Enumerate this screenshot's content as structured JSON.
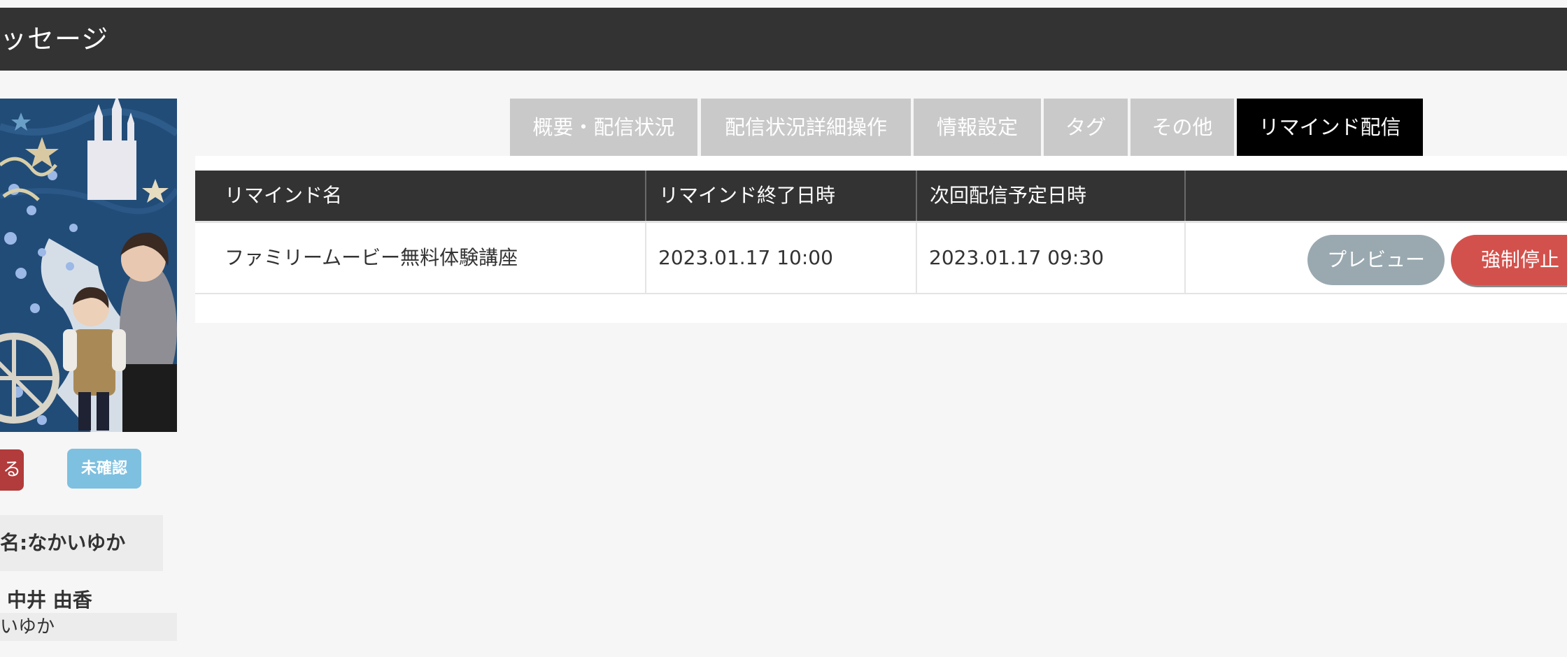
{
  "header": {
    "title": "ッセージ"
  },
  "profile": {
    "action_stub_label": "る",
    "status_badge": "未確認",
    "nickname": "名:なかいゆか",
    "real_name": "中井 由香",
    "kana": "いゆか"
  },
  "tabs": [
    {
      "label": "概要・配信状況",
      "active": false
    },
    {
      "label": "配信状況詳細操作",
      "active": false
    },
    {
      "label": "情報設定",
      "active": false
    },
    {
      "label": "タグ",
      "active": false
    },
    {
      "label": "その他",
      "active": false
    },
    {
      "label": "リマインド配信",
      "active": true
    }
  ],
  "table": {
    "headers": [
      "リマインド名",
      "リマインド終了日時",
      "次回配信予定日時",
      ""
    ],
    "rows": [
      {
        "name": "ファミリームービー無料体験講座",
        "end_datetime": "2023.01.17 10:00",
        "next_datetime": "2023.01.17 09:30",
        "preview_label": "プレビュー",
        "stop_label": "強制停止"
      }
    ]
  },
  "colors": {
    "header_bg": "#333333",
    "tab_inactive": "#c9c9c9",
    "tab_active": "#000000",
    "preview_button": "#9aa9b0",
    "stop_button": "#d3514c",
    "unconfirmed_badge": "#7ec0e0",
    "stub_button": "#b23b3b"
  }
}
